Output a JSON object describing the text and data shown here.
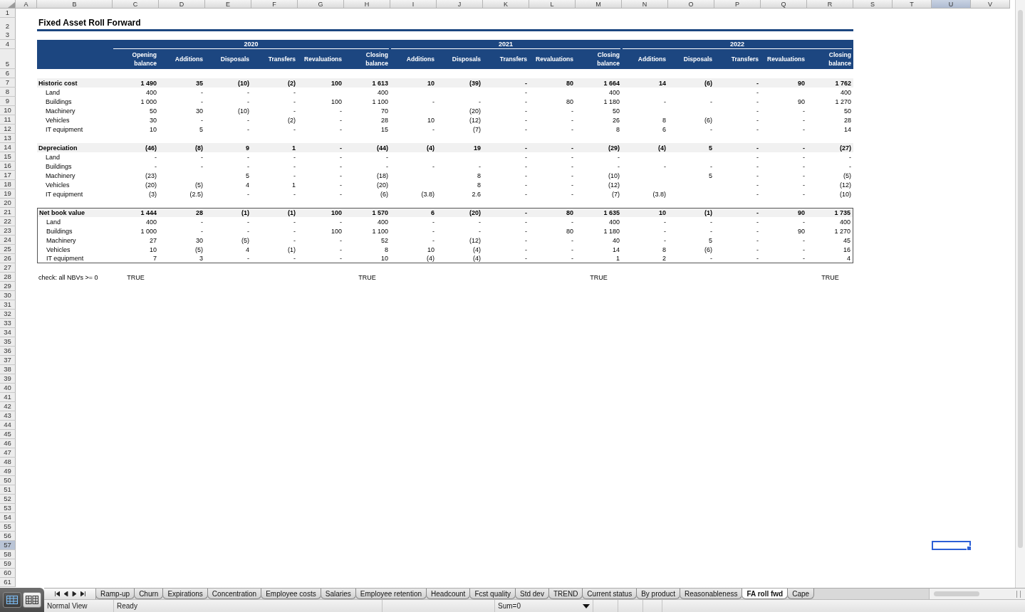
{
  "sheet": {
    "columns": [
      {
        "label": "A",
        "selected": false
      },
      {
        "label": "B",
        "selected": false
      },
      {
        "label": "C",
        "selected": false
      },
      {
        "label": "D",
        "selected": false
      },
      {
        "label": "E",
        "selected": false
      },
      {
        "label": "F",
        "selected": false
      },
      {
        "label": "G",
        "selected": false
      },
      {
        "label": "H",
        "selected": false
      },
      {
        "label": "I",
        "selected": false
      },
      {
        "label": "J",
        "selected": false
      },
      {
        "label": "K",
        "selected": false
      },
      {
        "label": "L",
        "selected": false
      },
      {
        "label": "M",
        "selected": false
      },
      {
        "label": "N",
        "selected": false
      },
      {
        "label": "O",
        "selected": false
      },
      {
        "label": "P",
        "selected": false
      },
      {
        "label": "Q",
        "selected": false
      },
      {
        "label": "R",
        "selected": false
      },
      {
        "label": "S",
        "selected": false
      },
      {
        "label": "T",
        "selected": false
      },
      {
        "label": "U",
        "selected": true
      },
      {
        "label": "V",
        "selected": false
      }
    ],
    "rows": [
      {
        "number": "1",
        "selected": false
      },
      {
        "number": "2",
        "selected": false
      },
      {
        "number": "3",
        "selected": false
      },
      {
        "number": "4",
        "selected": false
      },
      {
        "number": "5",
        "selected": false
      },
      {
        "number": "6",
        "selected": false
      },
      {
        "number": "7",
        "selected": false
      },
      {
        "number": "8",
        "selected": false
      },
      {
        "number": "9",
        "selected": false
      },
      {
        "number": "10",
        "selected": false
      },
      {
        "number": "11",
        "selected": false
      },
      {
        "number": "12",
        "selected": false
      },
      {
        "number": "13",
        "selected": false
      },
      {
        "number": "14",
        "selected": false
      },
      {
        "number": "15",
        "selected": false
      },
      {
        "number": "16",
        "selected": false
      },
      {
        "number": "17",
        "selected": false
      },
      {
        "number": "18",
        "selected": false
      },
      {
        "number": "19",
        "selected": false
      },
      {
        "number": "20",
        "selected": false
      },
      {
        "number": "21",
        "selected": false
      },
      {
        "number": "22",
        "selected": false
      },
      {
        "number": "23",
        "selected": false
      },
      {
        "number": "24",
        "selected": false
      },
      {
        "number": "25",
        "selected": false
      },
      {
        "number": "26",
        "selected": false
      },
      {
        "number": "27",
        "selected": false
      },
      {
        "number": "28",
        "selected": false
      },
      {
        "number": "29",
        "selected": false
      },
      {
        "number": "30",
        "selected": false
      },
      {
        "number": "31",
        "selected": false
      },
      {
        "number": "32",
        "selected": false
      },
      {
        "number": "33",
        "selected": false
      },
      {
        "number": "34",
        "selected": false
      },
      {
        "number": "35",
        "selected": false
      },
      {
        "number": "36",
        "selected": false
      },
      {
        "number": "37",
        "selected": false
      },
      {
        "number": "38",
        "selected": false
      },
      {
        "number": "39",
        "selected": false
      },
      {
        "number": "40",
        "selected": false
      },
      {
        "number": "41",
        "selected": false
      },
      {
        "number": "42",
        "selected": false
      },
      {
        "number": "43",
        "selected": false
      },
      {
        "number": "44",
        "selected": false
      },
      {
        "number": "45",
        "selected": false
      },
      {
        "number": "46",
        "selected": false
      },
      {
        "number": "47",
        "selected": false
      },
      {
        "number": "48",
        "selected": false
      },
      {
        "number": "49",
        "selected": false
      },
      {
        "number": "50",
        "selected": false
      },
      {
        "number": "51",
        "selected": false
      },
      {
        "number": "52",
        "selected": false
      },
      {
        "number": "53",
        "selected": false
      },
      {
        "number": "54",
        "selected": false
      },
      {
        "number": "55",
        "selected": false
      },
      {
        "number": "56",
        "selected": false
      },
      {
        "number": "57",
        "selected": true
      },
      {
        "number": "58",
        "selected": false
      },
      {
        "number": "59",
        "selected": false
      },
      {
        "number": "60",
        "selected": false
      },
      {
        "number": "61",
        "selected": false
      }
    ]
  },
  "report": {
    "title": "Fixed Asset Roll Forward",
    "years": [
      {
        "label": "2020",
        "columns": [
          "Opening balance",
          "Additions",
          "Disposals",
          "Transfers",
          "Revaluations",
          "Closing balance"
        ]
      },
      {
        "label": "2021",
        "columns": [
          "Additions",
          "Disposals",
          "Transfers",
          "Revaluations",
          "Closing balance"
        ]
      },
      {
        "label": "2022",
        "columns": [
          "Additions",
          "Disposals",
          "Transfers",
          "Revaluations",
          "Closing balance"
        ]
      }
    ],
    "sections": [
      {
        "label": "Historic cost",
        "boxed": false,
        "values": {
          "c1": "1 490",
          "c2": "35",
          "c3": "(10)",
          "c4": "(2)",
          "c5": "100",
          "c6": "1 613",
          "c7": "10",
          "c8": "(39)",
          "c9": "-",
          "c10": "80",
          "c11": "1 664",
          "c12": "14",
          "c13": "(6)",
          "c14": "-",
          "c15": "90",
          "c16": "1 762"
        },
        "items": [
          {
            "label": "Land",
            "values": {
              "c1": "400",
              "c2": "-",
              "c3": "-",
              "c4": "-",
              "c6": "400",
              "c9": "-",
              "c11": "400",
              "c14": "-",
              "c16": "400"
            }
          },
          {
            "label": "Buildings",
            "values": {
              "c1": "1 000",
              "c2": "-",
              "c3": "-",
              "c4": "-",
              "c5": "100",
              "c6": "1 100",
              "c7": "-",
              "c8": "-",
              "c9": "-",
              "c10": "80",
              "c11": "1 180",
              "c12": "-",
              "c13": "-",
              "c14": "-",
              "c15": "90",
              "c16": "1 270"
            }
          },
          {
            "label": "Machinery",
            "values": {
              "c1": "50",
              "c2": "30",
              "c3": "(10)",
              "c4": "-",
              "c5": "-",
              "c6": "70",
              "c8": "(20)",
              "c9": "-",
              "c10": "-",
              "c11": "50",
              "c14": "-",
              "c15": "-",
              "c16": "50"
            }
          },
          {
            "label": "Vehicles",
            "values": {
              "c1": "30",
              "c2": "-",
              "c3": "-",
              "c4": "(2)",
              "c5": "-",
              "c6": "28",
              "c7": "10",
              "c8": "(12)",
              "c9": "-",
              "c10": "-",
              "c11": "26",
              "c12": "8",
              "c13": "(6)",
              "c14": "-",
              "c15": "-",
              "c16": "28"
            }
          },
          {
            "label": "IT equipment",
            "values": {
              "c1": "10",
              "c2": "5",
              "c3": "-",
              "c4": "-",
              "c5": "-",
              "c6": "15",
              "c7": "-",
              "c8": "(7)",
              "c9": "-",
              "c10": "-",
              "c11": "8",
              "c12": "6",
              "c13": "-",
              "c14": "-",
              "c15": "-",
              "c16": "14"
            }
          }
        ]
      },
      {
        "label": "Depreciation",
        "boxed": false,
        "values": {
          "c1": "(46)",
          "c2": "(8)",
          "c3": "9",
          "c4": "1",
          "c5": "-",
          "c6": "(44)",
          "c7": "(4)",
          "c8": "19",
          "c9": "-",
          "c10": "-",
          "c11": "(29)",
          "c12": "(4)",
          "c13": "5",
          "c14": "-",
          "c15": "-",
          "c16": "(27)"
        },
        "items": [
          {
            "label": "Land",
            "values": {
              "c1": "-",
              "c2": "-",
              "c3": "-",
              "c4": "-",
              "c5": "-",
              "c6": "-",
              "c9": "-",
              "c10": "-",
              "c11": "-",
              "c14": "-",
              "c15": "-",
              "c16": "-"
            }
          },
          {
            "label": "Buildings",
            "values": {
              "c1": "-",
              "c2": "-",
              "c3": "-",
              "c4": "-",
              "c5": "-",
              "c6": "-",
              "c7": "-",
              "c8": "-",
              "c9": "-",
              "c10": "-",
              "c11": "-",
              "c12": "-",
              "c13": "-",
              "c14": "-",
              "c15": "-",
              "c16": "-"
            }
          },
          {
            "label": "Machinery",
            "values": {
              "c1": "(23)",
              "c3": "5",
              "c4": "-",
              "c5": "-",
              "c6": "(18)",
              "c8": "8",
              "c9": "-",
              "c10": "-",
              "c11": "(10)",
              "c13": "5",
              "c14": "-",
              "c15": "-",
              "c16": "(5)"
            }
          },
          {
            "label": "Vehicles",
            "values": {
              "c1": "(20)",
              "c2": "(5)",
              "c3": "4",
              "c4": "1",
              "c5": "-",
              "c6": "(20)",
              "c8": "8",
              "c9": "-",
              "c10": "-",
              "c11": "(12)",
              "c14": "-",
              "c15": "-",
              "c16": "(12)"
            }
          },
          {
            "label": "IT equipment",
            "values": {
              "c1": "(3)",
              "c2": "(2.5)",
              "c3": "-",
              "c4": "-",
              "c5": "-",
              "c6": "(6)",
              "c7": "(3.8)",
              "c8": "2.6",
              "c9": "-",
              "c10": "-",
              "c11": "(7)",
              "c12": "(3.8)",
              "c14": "-",
              "c15": "-",
              "c16": "(10)"
            }
          }
        ]
      },
      {
        "label": "Net book value",
        "boxed": true,
        "values": {
          "c1": "1 444",
          "c2": "28",
          "c3": "(1)",
          "c4": "(1)",
          "c5": "100",
          "c6": "1 570",
          "c7": "6",
          "c8": "(20)",
          "c9": "-",
          "c10": "80",
          "c11": "1 635",
          "c12": "10",
          "c13": "(1)",
          "c14": "-",
          "c15": "90",
          "c16": "1 735"
        },
        "items": [
          {
            "label": "Land",
            "values": {
              "c1": "400",
              "c2": "-",
              "c3": "-",
              "c4": "-",
              "c5": "-",
              "c6": "400",
              "c7": "-",
              "c8": "-",
              "c9": "-",
              "c10": "-",
              "c11": "400",
              "c12": "-",
              "c13": "-",
              "c14": "-",
              "c15": "-",
              "c16": "400"
            }
          },
          {
            "label": "Buildings",
            "values": {
              "c1": "1 000",
              "c2": "-",
              "c3": "-",
              "c4": "-",
              "c5": "100",
              "c6": "1 100",
              "c7": "-",
              "c8": "-",
              "c9": "-",
              "c10": "80",
              "c11": "1 180",
              "c12": "-",
              "c13": "-",
              "c14": "-",
              "c15": "90",
              "c16": "1 270"
            }
          },
          {
            "label": "Machinery",
            "values": {
              "c1": "27",
              "c2": "30",
              "c3": "(5)",
              "c4": "-",
              "c5": "-",
              "c6": "52",
              "c7": "-",
              "c8": "(12)",
              "c9": "-",
              "c10": "-",
              "c11": "40",
              "c12": "-",
              "c13": "5",
              "c14": "-",
              "c15": "-",
              "c16": "45"
            }
          },
          {
            "label": "Vehicles",
            "values": {
              "c1": "10",
              "c2": "(5)",
              "c3": "4",
              "c4": "(1)",
              "c5": "-",
              "c6": "8",
              "c7": "10",
              "c8": "(4)",
              "c9": "-",
              "c10": "-",
              "c11": "14",
              "c12": "8",
              "c13": "(6)",
              "c14": "-",
              "c15": "-",
              "c16": "16"
            }
          },
          {
            "label": "IT equipment",
            "values": {
              "c1": "7",
              "c2": "3",
              "c3": "-",
              "c4": "-",
              "c5": "-",
              "c6": "10",
              "c7": "(4)",
              "c8": "(4)",
              "c9": "-",
              "c10": "-",
              "c11": "1",
              "c12": "2",
              "c13": "-",
              "c14": "-",
              "c15": "-",
              "c16": "4"
            }
          }
        ]
      }
    ],
    "check": {
      "label": "check: all NBVs >= 0",
      "values": {
        "c1": "TRUE",
        "c6": "TRUE",
        "c11": "TRUE",
        "c16": "TRUE"
      }
    }
  },
  "view_buttons": [
    {
      "kind": "normal",
      "selected": true
    },
    {
      "kind": "page_layout",
      "selected": false
    }
  ],
  "tabs": [
    {
      "label": "Ramp-up",
      "selected": false
    },
    {
      "label": "Churn",
      "selected": false
    },
    {
      "label": "Expirations",
      "selected": false
    },
    {
      "label": "Concentration",
      "selected": false
    },
    {
      "label": "Employee costs",
      "selected": false
    },
    {
      "label": "Salaries",
      "selected": false
    },
    {
      "label": "Employee retention",
      "selected": false
    },
    {
      "label": "Headcount",
      "selected": false
    },
    {
      "label": "Fcst quality",
      "selected": false
    },
    {
      "label": "Std dev",
      "selected": false
    },
    {
      "label": "TREND",
      "selected": false
    },
    {
      "label": "Current status",
      "selected": false
    },
    {
      "label": "By product",
      "selected": false
    },
    {
      "label": "Reasonableness",
      "selected": false
    },
    {
      "label": "FA roll fwd",
      "selected": true
    },
    {
      "label": "Cape",
      "selected": false
    }
  ],
  "status_bar": {
    "view": "Normal View",
    "state": "Ready",
    "sum": "Sum=0"
  }
}
